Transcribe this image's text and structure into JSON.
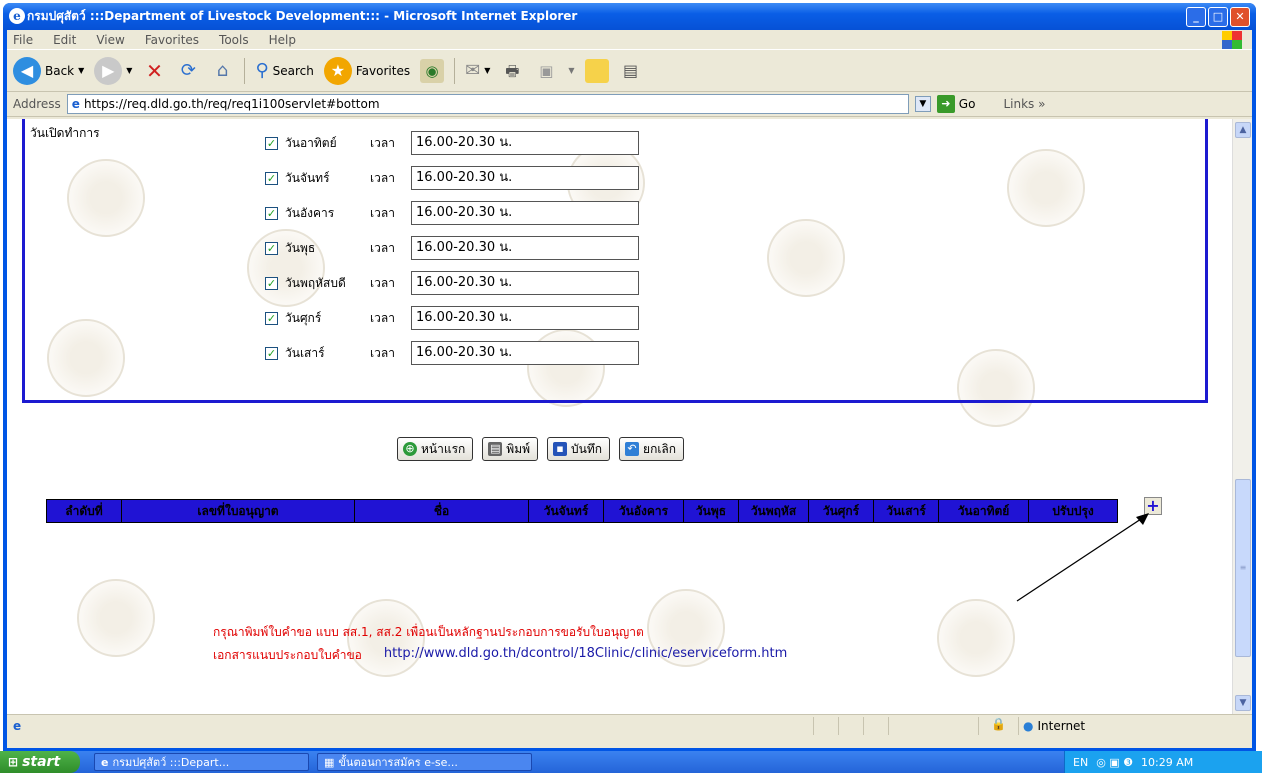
{
  "window": {
    "title": "กรมปศุสัตว์ :::Department of Livestock Development::: - Microsoft Internet Explorer"
  },
  "menu": [
    "File",
    "Edit",
    "View",
    "Favorites",
    "Tools",
    "Help"
  ],
  "toolbar": {
    "back": "Back",
    "search": "Search",
    "favorites": "Favorites"
  },
  "address": {
    "label": "Address",
    "url": "https://req.dld.go.th/req/req1i100servlet#bottom",
    "go": "Go",
    "links": "Links"
  },
  "form": {
    "open_label": "วันเปิดทำการ",
    "time_label": "เวลา",
    "days": [
      {
        "name": "วันอาทิตย์",
        "time": "16.00-20.30 น."
      },
      {
        "name": "วันจันทร์",
        "time": "16.00-20.30 น."
      },
      {
        "name": "วันอังคาร",
        "time": "16.00-20.30 น."
      },
      {
        "name": "วันพุธ",
        "time": "16.00-20.30 น."
      },
      {
        "name": "วันพฤหัสบดี",
        "time": "16.00-20.30 น."
      },
      {
        "name": "วันศุกร์",
        "time": "16.00-20.30 น."
      },
      {
        "name": "วันเสาร์",
        "time": "16.00-20.30 น."
      }
    ]
  },
  "buttons": {
    "home": "หน้าแรก",
    "print": "พิมพ์",
    "save": "บันทึก",
    "cancel": "ยกเลิก"
  },
  "table": {
    "headers": [
      "ลำดับที่",
      "เลขที่ใบอนุญาต",
      "ชื่อ",
      "วันจันทร์",
      "วันอังคาร",
      "วันพุธ",
      "วันพฤหัส",
      "วันศุกร์",
      "วันเสาร์",
      "วันอาทิตย์",
      "ปรับปรุง"
    ],
    "add_symbol": "+"
  },
  "notes": {
    "line1": "กรุณาพิมพ์ใบคำขอ แบบ สส.1, สส.2 เพื่อนเป็นหลักฐานประกอบการขอรับใบอนุญาต",
    "line2_label": "เอกสารแนบประกอบใบคำขอ",
    "line2_url": "http://www.dld.go.th/dcontrol/18Clinic/clinic/eserviceform.htm"
  },
  "status": {
    "zone": "Internet"
  },
  "taskbar": {
    "start": "start",
    "tasks": [
      "กรมปศุสัตว์ :::Depart...",
      "ขั้นตอนการสมัคร e-se..."
    ],
    "lang": "EN",
    "clock": "10:29 AM"
  },
  "colors": {
    "panel_border": "#1c1ad0",
    "table_header": "#2013d4",
    "note_red": "#e00000"
  }
}
